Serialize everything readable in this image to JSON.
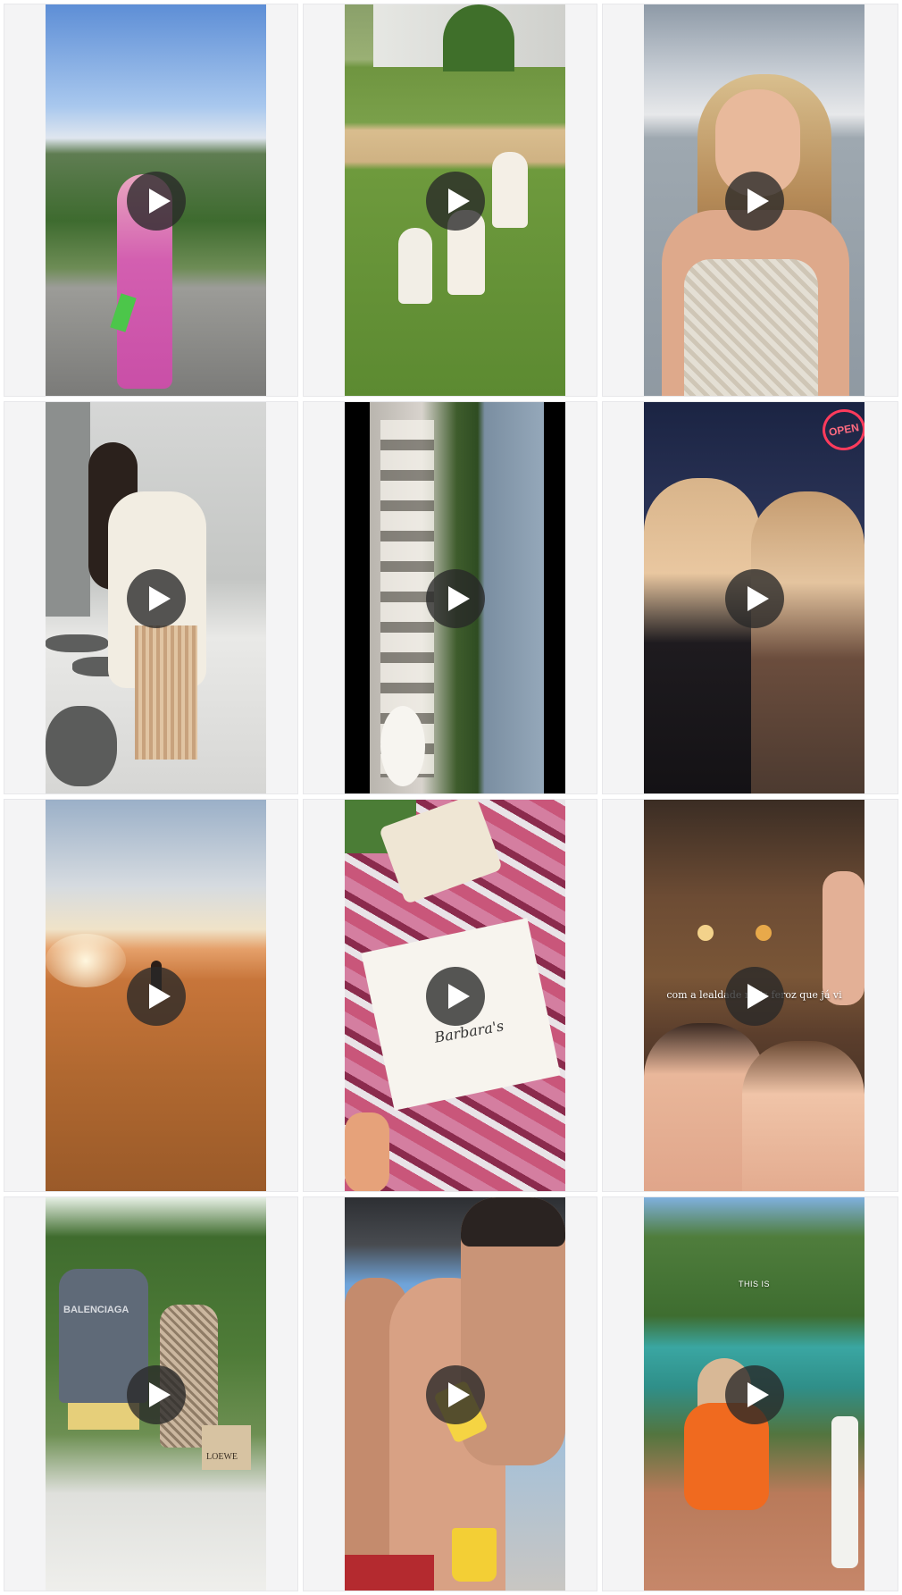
{
  "grid": {
    "items": [
      {
        "type": "video",
        "scene": "pink dress on terrace",
        "caption": ""
      },
      {
        "type": "video",
        "scene": "children in white dresses on lawn",
        "caption": ""
      },
      {
        "type": "video",
        "scene": "woman selfie by sea",
        "caption": ""
      },
      {
        "type": "video",
        "scene": "woman in white dress with fringe bag",
        "caption": ""
      },
      {
        "type": "video",
        "scene": "rotated view of outdoor party",
        "caption": ""
      },
      {
        "type": "video",
        "scene": "two women at night with OPEN sign",
        "caption": "",
        "sign_text": "OPEN"
      },
      {
        "type": "video",
        "scene": "sunrise over desert dunes",
        "caption": ""
      },
      {
        "type": "video",
        "scene": "handwritten note on picnic blanket",
        "caption": "",
        "note_text": "Barbara's"
      },
      {
        "type": "video",
        "scene": "friends at table with drinks",
        "caption": "com a lealdade mais feroz que já vi"
      },
      {
        "type": "video",
        "scene": "couple posing in garden",
        "caption": "",
        "shirt_text": "BALENCIAGA",
        "bag_text": "LOEWE"
      },
      {
        "type": "video",
        "scene": "three men selfie shirtless",
        "caption": ""
      },
      {
        "type": "video",
        "scene": "woman in orange on steps by cove",
        "caption": "THIS IS"
      }
    ]
  },
  "icons": {
    "play": "play-icon"
  },
  "colors": {
    "cell_bg": "#f4f4f5",
    "play_bg": "#282828",
    "play_fg": "#ffffff"
  }
}
